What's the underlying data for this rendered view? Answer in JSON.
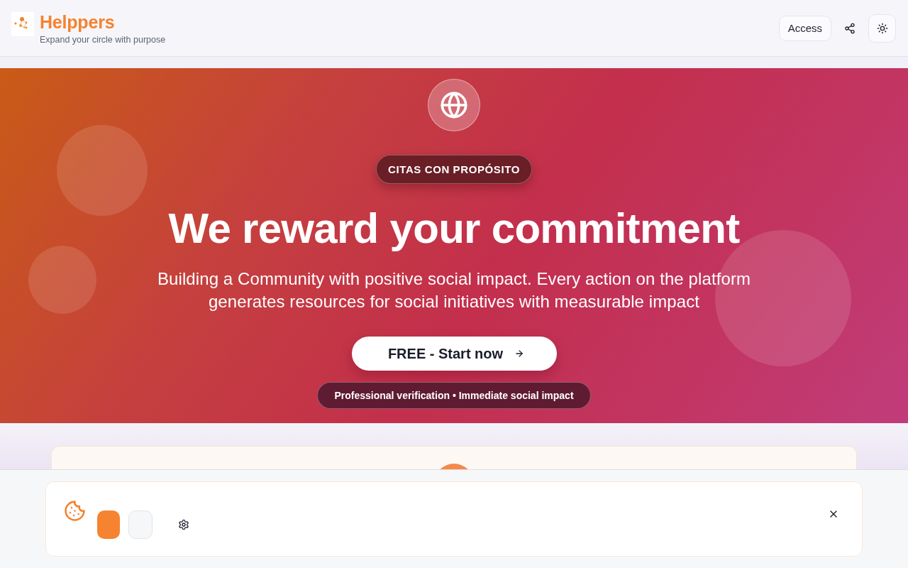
{
  "header": {
    "brand": {
      "name": "Helppers",
      "tagline": "Expand your circle with purpose"
    },
    "access_label": "Access"
  },
  "hero": {
    "badge": "CITAS CON PROPÓSITO",
    "title": "We reward your commitment",
    "description": "Building a Community with positive social impact. Every action on the platform generates resources for social initiatives with measurable impact",
    "cta": {
      "label": "FREE - Start now"
    },
    "note": "Professional verification • Immediate social impact"
  },
  "cookie_banner": {
    "buttons": [
      {
        "kind": "primary"
      },
      {
        "kind": "secondary"
      }
    ]
  }
}
